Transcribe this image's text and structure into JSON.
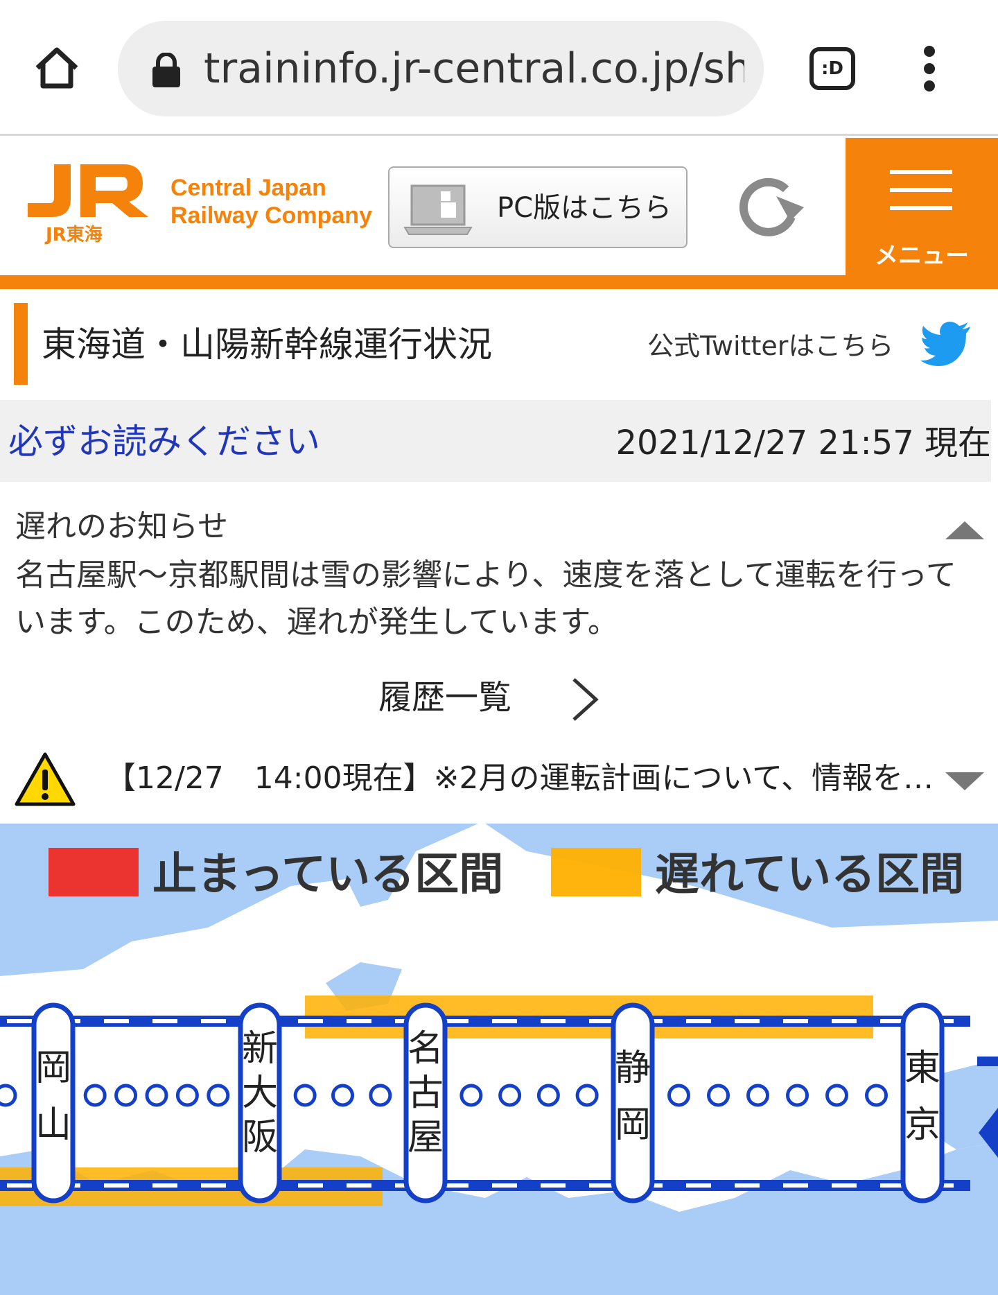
{
  "browser": {
    "url": "traininfo.jr-central.co.jp/shinkansen/sp/ja/",
    "tab_icon_label": ":D"
  },
  "header": {
    "logo_sub": "JR東海",
    "company_line1": "Central Japan",
    "company_line2": "Railway Company",
    "pc_button_label": "PC版はこちら",
    "menu_label": "メニュー",
    "brand_color": "#f5820a"
  },
  "title": {
    "text": "東海道・山陽新幹線運行状況",
    "twitter_label": "公式Twitterはこちら"
  },
  "notice": {
    "read_link": "必ずお読みください",
    "timestamp": "2021/12/27 21:57 現在"
  },
  "delay": {
    "title": "遅れのお知らせ",
    "body": "名古屋駅〜京都駅間は雪の影響により、速度を落として運転を行っています。このため、遅れが発生しています。"
  },
  "history_label": "履歴一覧",
  "alert_text": "【12/27　14:00現在】※2月の運転計画について、情報を…",
  "map": {
    "legend": [
      {
        "label": "止まっている区間",
        "color": "#ee2a24"
      },
      {
        "label": "遅れている区間",
        "color": "#ffb000"
      }
    ],
    "stations": [
      {
        "name": "岡山",
        "chars": [
          "岡",
          "山"
        ]
      },
      {
        "name": "新大阪",
        "chars": [
          "新",
          "大",
          "阪"
        ]
      },
      {
        "name": "名古屋",
        "chars": [
          "名",
          "古",
          "屋"
        ]
      },
      {
        "name": "静岡",
        "chars": [
          "静",
          "岡"
        ]
      },
      {
        "name": "東京",
        "chars": [
          "東",
          "京"
        ]
      }
    ],
    "intermediate_counts": [
      5,
      3,
      4,
      6
    ],
    "line_color": "#1440c8",
    "sea_color": "#a9cdf7"
  }
}
